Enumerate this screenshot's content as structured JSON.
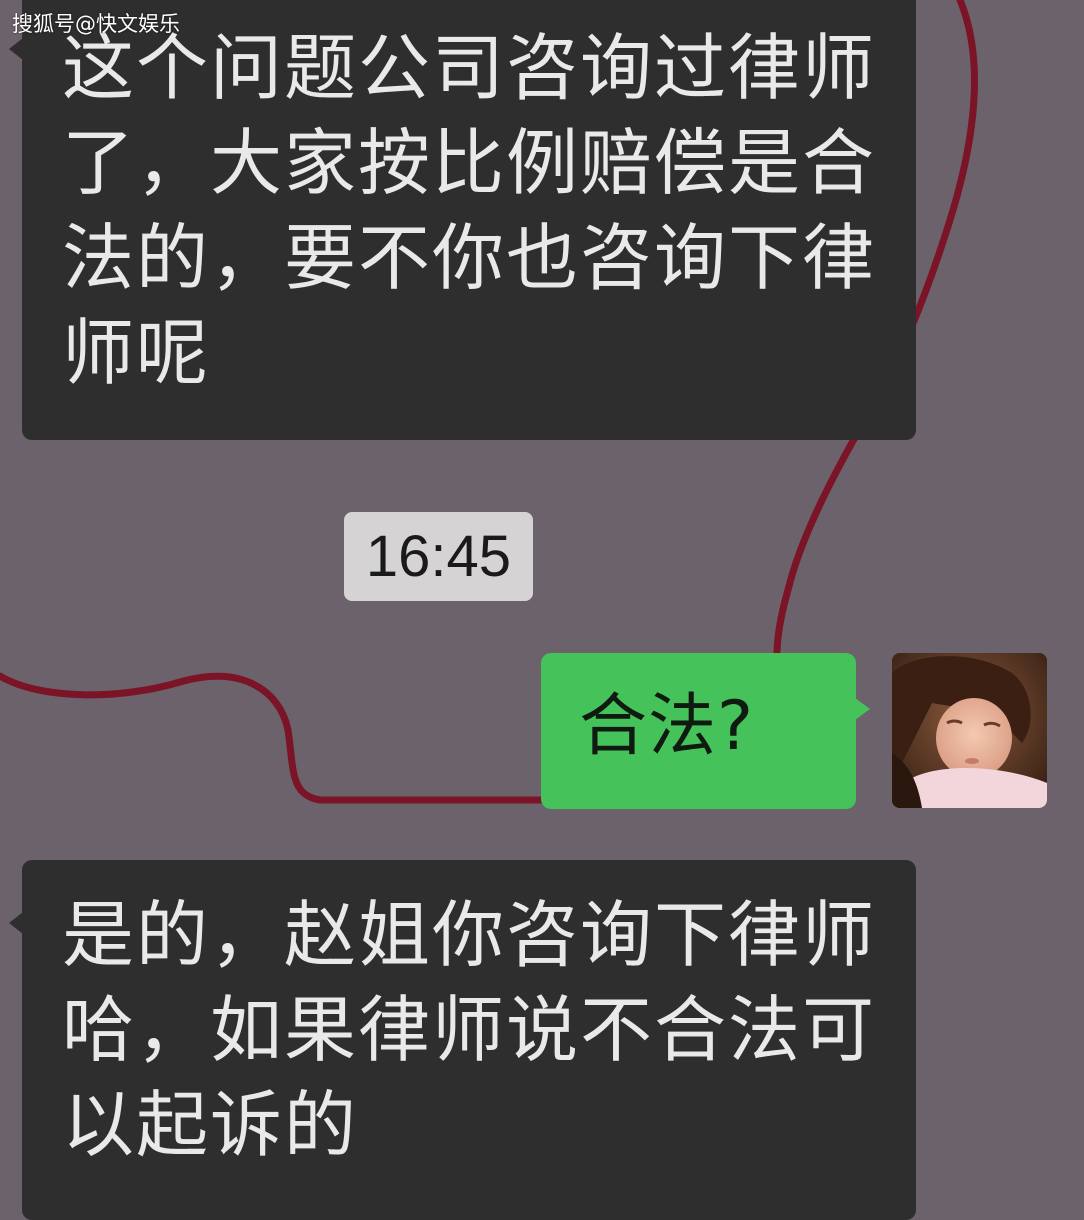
{
  "watermark": "搜狐号@快文娱乐",
  "messages": [
    {
      "side": "left",
      "text": "这个问题公司咨询过律师了，大家按比例赔偿是合法的，要不你也咨询下律师呢"
    },
    {
      "side": "right",
      "text": "合法?"
    },
    {
      "side": "left",
      "text": "是的，赵姐你咨询下律师哈，如果律师说不合法可以起诉的"
    }
  ],
  "timestamp": "16:45",
  "colors": {
    "background": "#6c626b",
    "left_bubble": "#2e2e2e",
    "right_bubble": "#45c25a",
    "timestamp_bg": "#d6d3d5",
    "doodle_line": "#7a1426"
  },
  "avatar": {
    "icon": "sleeping-child-photo"
  }
}
